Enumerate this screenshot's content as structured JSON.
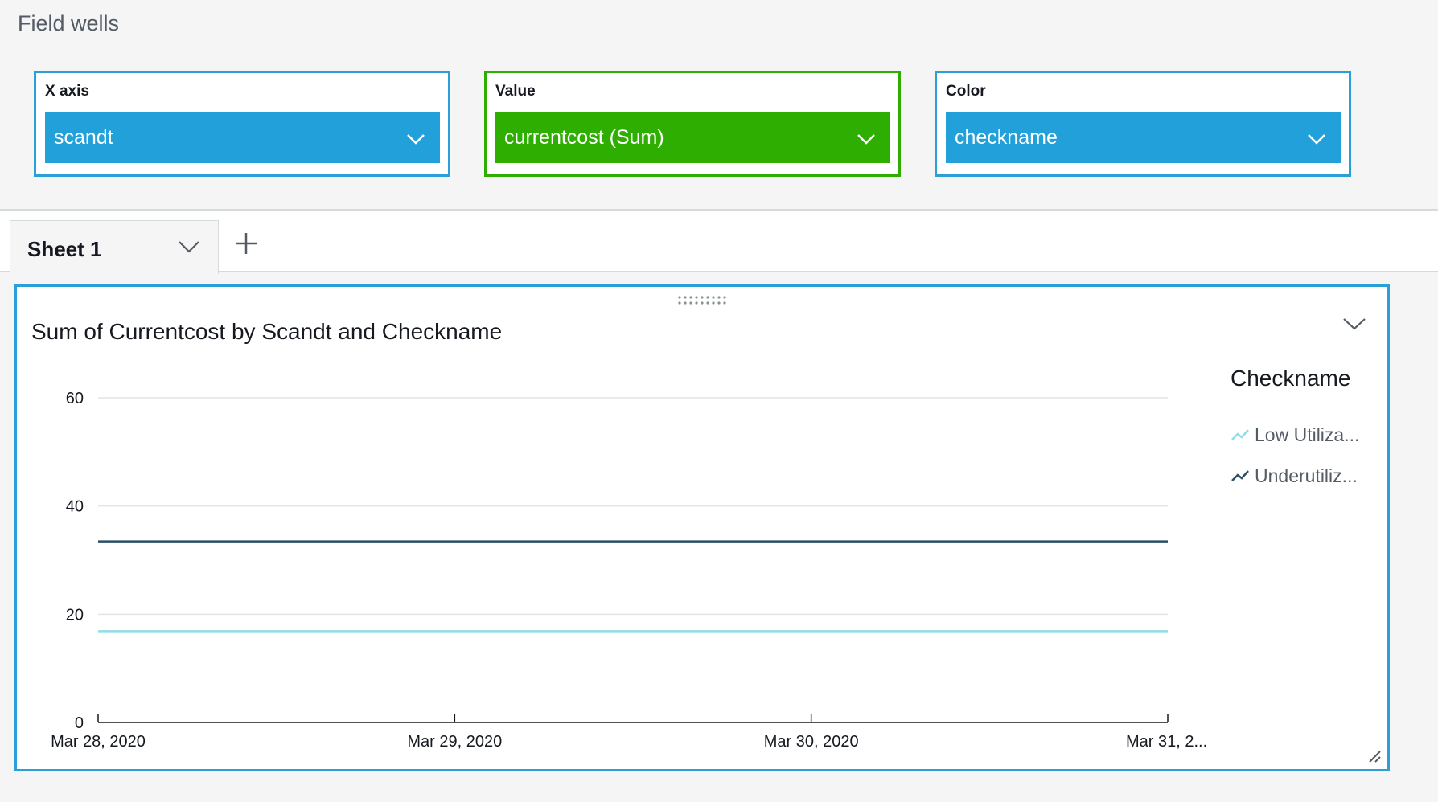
{
  "field_wells": {
    "title": "Field wells",
    "wells": [
      {
        "label": "X axis",
        "field": "scandt"
      },
      {
        "label": "Value",
        "field": "currentcost (Sum)"
      },
      {
        "label": "Color",
        "field": "checkname"
      }
    ]
  },
  "sheets": {
    "active_tab": "Sheet 1",
    "add_icon": "plus-icon"
  },
  "colors": {
    "accent_blue": "#2a9fd8",
    "field_green": "#2eae01",
    "series_low": "#8fdde8",
    "series_under": "#2b4f66"
  },
  "visual": {
    "title": "Sum of Currentcost by Scandt and Checkname",
    "menu_icon": "chevron-down-icon",
    "legend": {
      "title": "Checkname",
      "items": [
        "Low Utiliza...",
        "Underutiliz..."
      ]
    }
  },
  "chart_data": {
    "type": "line",
    "title": "Sum of Currentcost by Scandt and Checkname",
    "xlabel": "",
    "ylabel": "",
    "categories": [
      "Mar 28, 2020",
      "Mar 29, 2020",
      "Mar 30, 2020",
      "Mar 31, 2..."
    ],
    "y_ticks": [
      "0",
      "20",
      "40",
      "60"
    ],
    "ylim": [
      0,
      60
    ],
    "grid": true,
    "legend_position": "right",
    "series": [
      {
        "name": "Low Utiliza...",
        "values": [
          16.8,
          16.8,
          16.8,
          16.8
        ],
        "color": "#8fdde8"
      },
      {
        "name": "Underutiliz...",
        "values": [
          33.4,
          33.4,
          33.4,
          33.4
        ],
        "color": "#2b4f66"
      }
    ]
  }
}
